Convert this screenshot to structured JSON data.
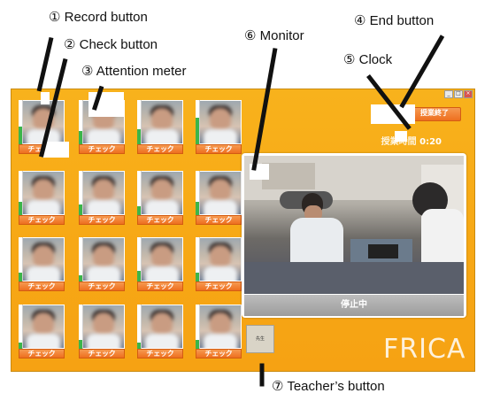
{
  "window": {
    "controls": [
      "_",
      "□",
      "×"
    ]
  },
  "grid": {
    "check_label": "チェック",
    "students": [
      {
        "meter_pct": 40
      },
      {
        "meter_pct": 30
      },
      {
        "meter_pct": 35
      },
      {
        "meter_pct": 60
      },
      {
        "meter_pct": 30
      },
      {
        "meter_pct": 25
      },
      {
        "meter_pct": 20
      },
      {
        "meter_pct": 30
      },
      {
        "meter_pct": 20
      },
      {
        "meter_pct": 15
      },
      {
        "meter_pct": 25
      },
      {
        "meter_pct": 20
      },
      {
        "meter_pct": 15
      },
      {
        "meter_pct": 20
      },
      {
        "meter_pct": 15
      },
      {
        "meter_pct": 20
      }
    ]
  },
  "header": {
    "end_button_label": "授業終了",
    "timer_label": "授業時間",
    "timer_value": "0:20"
  },
  "monitor": {
    "status": "停止中"
  },
  "teacher_button_label": "先生",
  "logo": "FRICA",
  "annotations": {
    "record": "① Record button",
    "check": "② Check button",
    "attention": "③ Attention meter",
    "end": "④ End button",
    "clock": "⑤ Clock",
    "monitor": "⑥ Monitor",
    "teacher": "⑦ Teacher’s button"
  },
  "colors": {
    "background": "#f7a815",
    "check_button": "#ee6f1f",
    "meter_fill": "#3bb54a"
  }
}
